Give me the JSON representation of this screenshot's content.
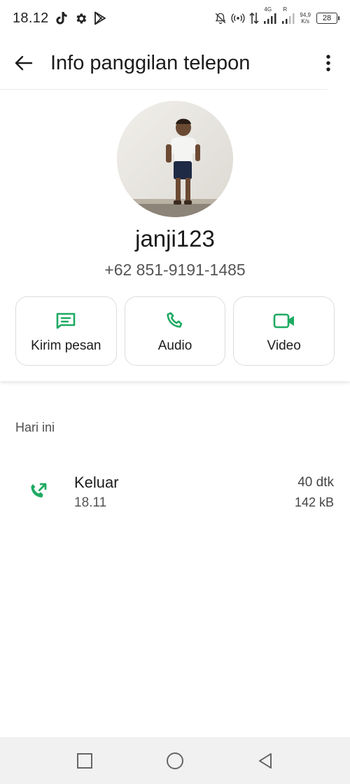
{
  "status_bar": {
    "time": "18.12",
    "network_type": "4G",
    "roaming": "R",
    "net_speed_value": "94,9",
    "net_speed_unit": "K/s",
    "battery": "28"
  },
  "app_bar": {
    "title": "Info panggilan telepon"
  },
  "contact": {
    "name": "janji123",
    "phone": "+62 851-9191-1485"
  },
  "actions": [
    {
      "label": "Kirim pesan",
      "icon": "message-icon"
    },
    {
      "label": "Audio",
      "icon": "phone-icon"
    },
    {
      "label": "Video",
      "icon": "video-icon"
    }
  ],
  "history": {
    "section_label": "Hari ini",
    "calls": [
      {
        "type": "Keluar",
        "time": "18.11",
        "duration": "40 dtk",
        "size": "142 kB",
        "icon": "outgoing-call-icon"
      }
    ]
  },
  "colors": {
    "accent_green": "#1DAA61",
    "text_primary": "#1c1c1c",
    "text_secondary": "#555555",
    "nav_bg": "#f1f1f1"
  }
}
